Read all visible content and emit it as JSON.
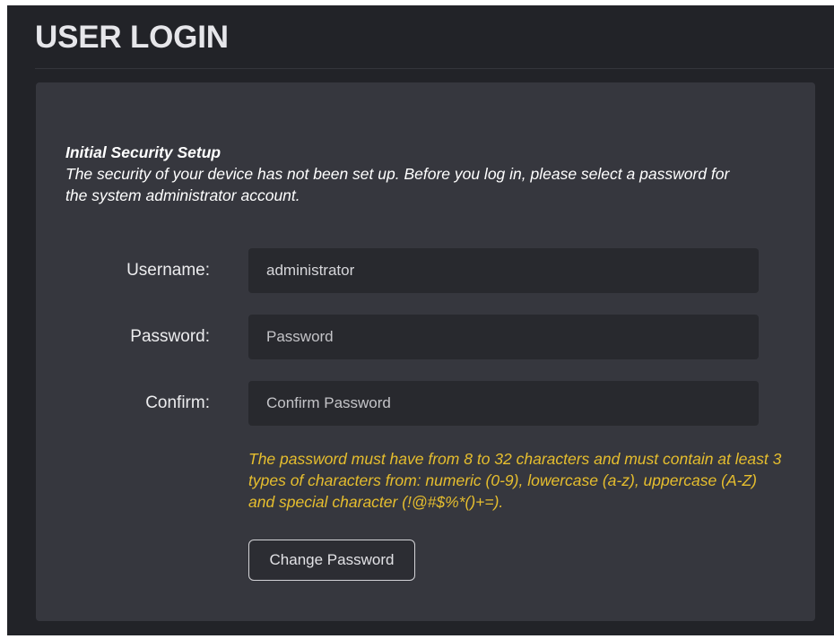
{
  "page": {
    "title": "USER LOGIN"
  },
  "setup": {
    "heading": "Initial Security Setup",
    "description": "The security of your device has not been set up. Before you log in, please select a password for the system administrator account."
  },
  "form": {
    "username": {
      "label": "Username:",
      "value": "administrator",
      "placeholder": ""
    },
    "password": {
      "label": "Password:",
      "value": "",
      "placeholder": "Password"
    },
    "confirm": {
      "label": "Confirm:",
      "value": "",
      "placeholder": "Confirm Password"
    },
    "hint": "The password must have from 8 to 32 characters and must contain at least 3 types of characters from: numeric (0-9), lowercase (a-z), uppercase (A-Z) and special character (!@#$%*()+=).",
    "submit_label": "Change Password"
  },
  "colors": {
    "background": "#222328",
    "panel": "#36373e",
    "input": "#28292e",
    "hint": "#e6be2e"
  }
}
